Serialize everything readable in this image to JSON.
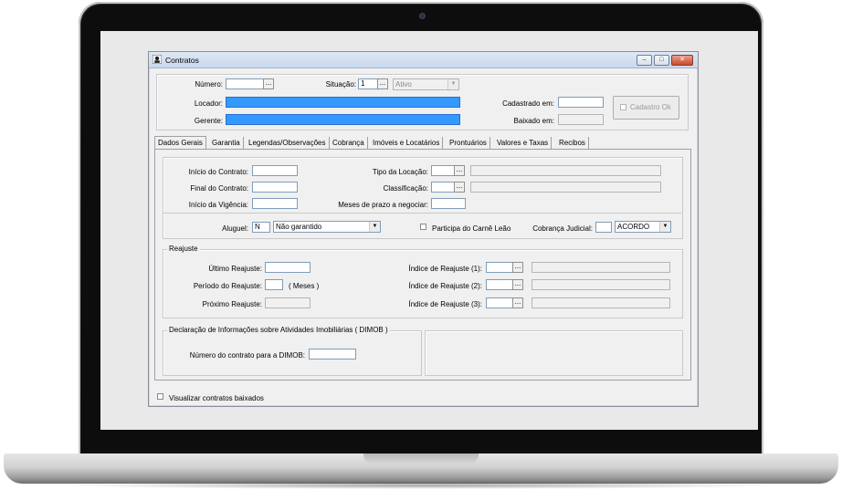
{
  "window": {
    "title": "Contratos",
    "min_label": "–",
    "max_label": "□",
    "close_label": "✕"
  },
  "header": {
    "numero_label": "Número:",
    "numero_value": "",
    "situacao_label": "Situação:",
    "situacao_code": "1",
    "situacao_value": "Ativo",
    "locador_label": "Locador:",
    "gerente_label": "Gerente:",
    "cadastrado_label": "Cadastrado em:",
    "baixado_label": "Baixado em:",
    "cadastro_ok_label": "Cadastro Ok",
    "dots": "..."
  },
  "tabs": [
    {
      "label": "Dados Gerais"
    },
    {
      "label": "Garantia"
    },
    {
      "label": "Legendas/Observações"
    },
    {
      "label": "Cobrança"
    },
    {
      "label": "Imóveis e Locatários"
    },
    {
      "label": "Prontuários"
    },
    {
      "label": "Valores e Taxas"
    },
    {
      "label": "Recibos"
    }
  ],
  "dados": {
    "inicio_contrato": "Início do Contrato:",
    "final_contrato": "Final do Contrato:",
    "inicio_vigencia": "Início da Vigência:",
    "tipo_locacao": "Tipo da Locação:",
    "classificacao": "Classificação:",
    "meses_prazo": "Meses de prazo a negociar:",
    "aluguel_label": "Aluguel:",
    "aluguel_code": "N",
    "aluguel_value": "Não garantido",
    "carne_leao": "Participa do Carnê Leão",
    "cobranca_judicial": "Cobrança Judicial:",
    "cobranca_value": "ACORDO"
  },
  "reajuste": {
    "title": "Reajuste",
    "ultimo": "Último Reajuste:",
    "periodo": "Período do Reajuste:",
    "meses": "( Meses )",
    "proximo": "Próximo Reajuste:",
    "indice1": "Índice de Reajuste (1):",
    "indice2": "Índice de Reajuste (2):",
    "indice3": "Índice de Reajuste (3):"
  },
  "dimob": {
    "title": "Declaração de Informações sobre Atividades Imobiliárias ( DIMOB )",
    "numero_label": "Número do contrato para a DIMOB:"
  },
  "footer": {
    "visualizar_baixados": "Visualizar contratos baixados"
  },
  "colors": {
    "selection_blue": "#3399ff",
    "window_bg": "#f0f0f0",
    "close_red": "#c7492c"
  }
}
